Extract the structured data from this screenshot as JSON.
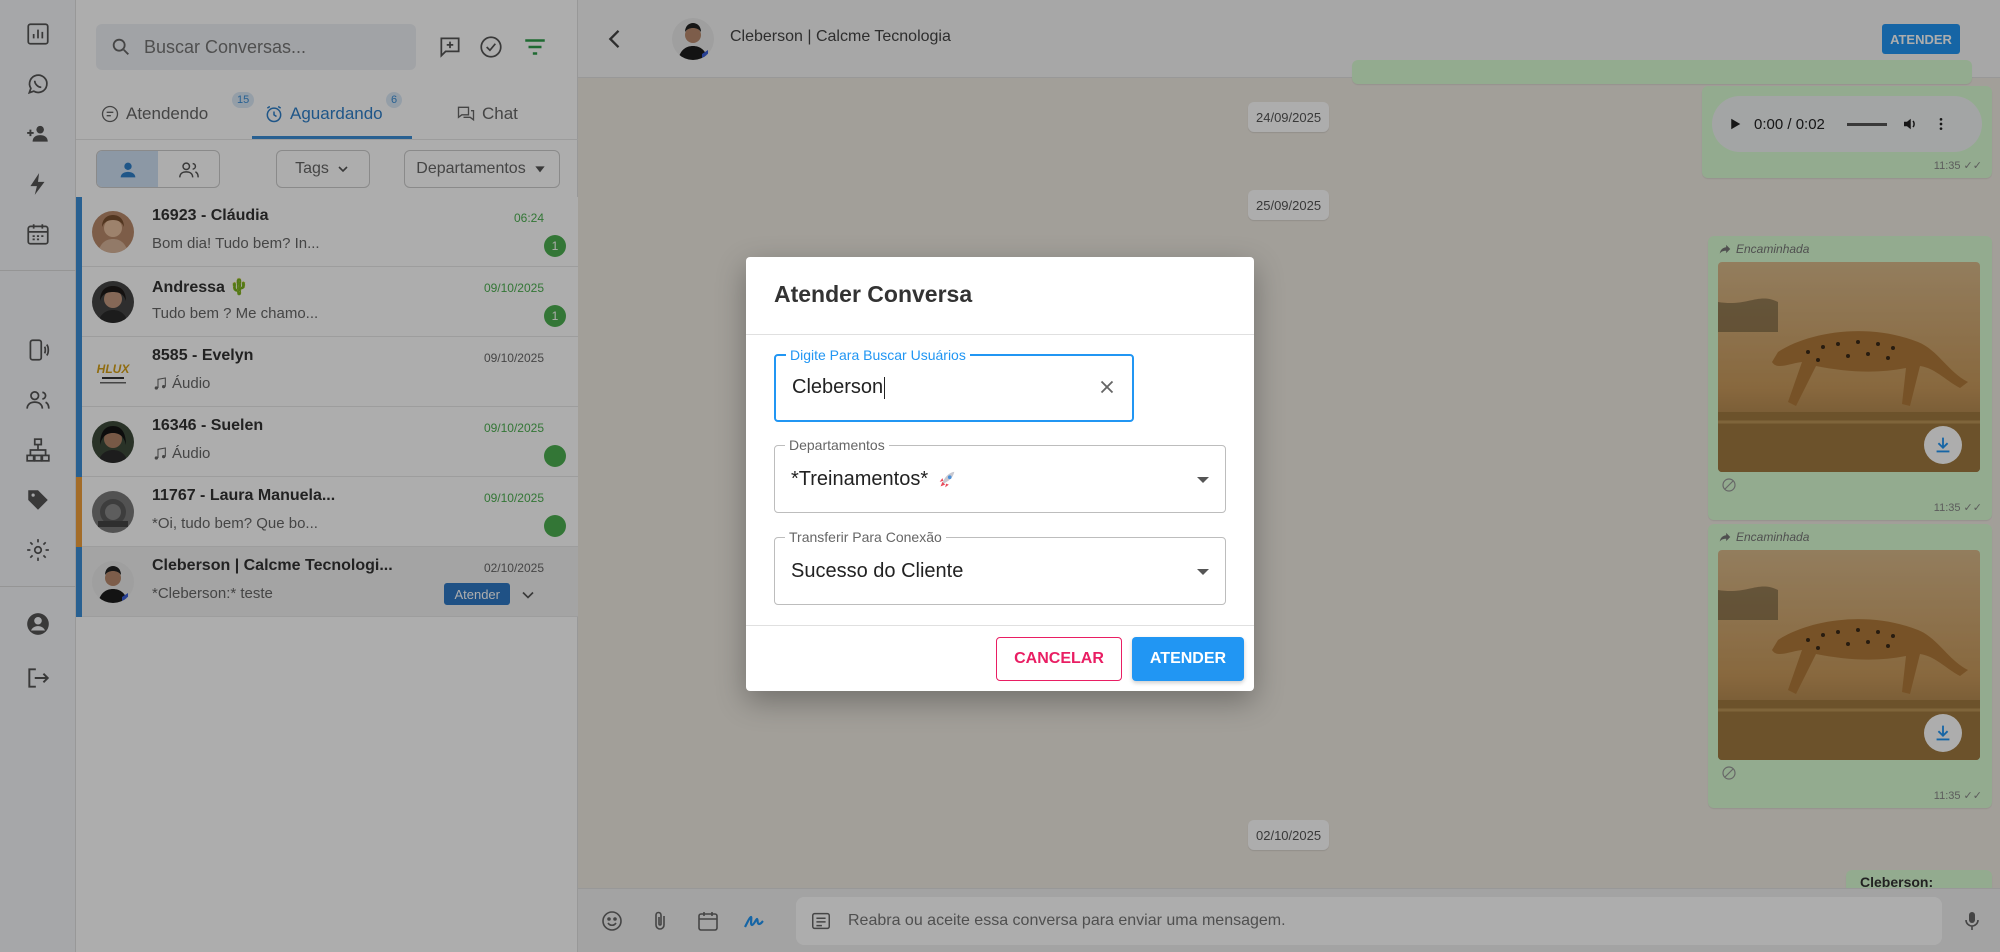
{
  "colors": {
    "accent": "#2196f3",
    "cancel": "#e91e63",
    "unread": "#4caf50",
    "bar_blue": "#3b8ed6",
    "bar_orange": "#f0a03c"
  },
  "sidebar": {
    "icons": [
      "dashboard-icon",
      "whatsapp-icon",
      "add-user-icon",
      "lightning-icon",
      "calendar-icon",
      "device-icon",
      "users-icon",
      "hierarchy-icon",
      "tag-icon",
      "settings-icon",
      "account-icon",
      "logout-icon"
    ]
  },
  "list": {
    "search_placeholder": "Buscar Conversas...",
    "tabs": [
      {
        "label": "Atendendo",
        "count": "15"
      },
      {
        "label": "Aguardando",
        "count": "6"
      },
      {
        "label": "Chat",
        "count": ""
      }
    ],
    "filters": {
      "tags": "Tags",
      "departments": "Departamentos"
    },
    "conversations": [
      {
        "name": "16923 - Cláudia",
        "preview": "Bom dia! Tudo bem? In...",
        "time": "06:24",
        "unread": "1",
        "time_green": true
      },
      {
        "name": "Andressa 🌵",
        "preview": "Tudo bem ? Me chamo...",
        "time": "09/10/2025",
        "unread": "1",
        "time_green": true
      },
      {
        "name": "8585 - Evelyn",
        "preview": "Áudio",
        "time": "09/10/2025",
        "unread": "",
        "time_green": false
      },
      {
        "name": "16346 - Suelen",
        "preview": "Áudio",
        "time": "09/10/2025",
        "unread": "",
        "time_green": true
      },
      {
        "name": "11767 - Laura Manuela...",
        "preview": "*Oi, tudo bem? Que bo...",
        "time": "09/10/2025",
        "unread": "",
        "time_green": true
      },
      {
        "name": "Cleberson | Calcme Tecnologi...",
        "preview": "*Cleberson:* teste",
        "time": "02/10/2025",
        "unread": "",
        "time_green": false,
        "action": "Atender"
      }
    ],
    "logo_text": "HLUX"
  },
  "chat": {
    "contact_name": "Cleberson | Calcme Tecnologia",
    "header_button": "ATENDER",
    "dates": [
      "24/09/2025",
      "25/09/2025",
      "02/10/2025"
    ],
    "audio": {
      "time": "0:00 / 0:02",
      "stamp": "11:35"
    },
    "forwarded_label": "Encaminhada",
    "image_times": [
      "11:35",
      "11:35"
    ],
    "last_sender": "Cleberson:",
    "input_placeholder": "Reabra ou aceite essa conversa para enviar uma mensagem."
  },
  "modal": {
    "title": "Atender Conversa",
    "user_field": {
      "label": "Digite Para Buscar Usuários",
      "value": "Cleberson"
    },
    "department_field": {
      "label": "Departamentos",
      "value": "*Treinamentos*"
    },
    "connection_field": {
      "label": "Transferir Para Conexão",
      "value": "Sucesso do Cliente"
    },
    "cancel_label": "CANCELAR",
    "confirm_label": "ATENDER"
  }
}
